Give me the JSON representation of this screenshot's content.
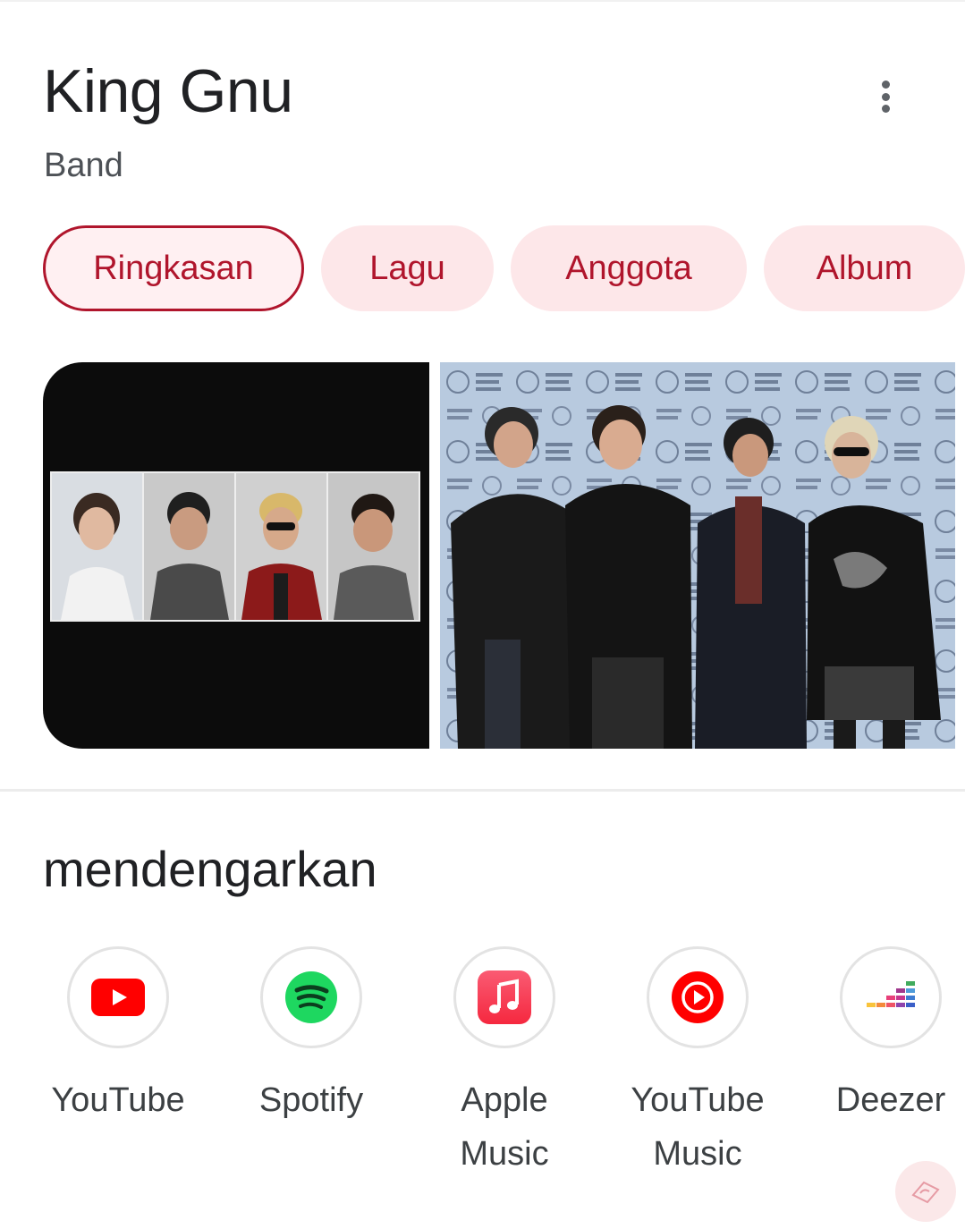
{
  "header": {
    "title": "King Gnu",
    "subtitle": "Band"
  },
  "tabs": [
    {
      "label": "Ringkasan",
      "active": true
    },
    {
      "label": "Lagu",
      "active": false
    },
    {
      "label": "Anggota",
      "active": false
    },
    {
      "label": "Album",
      "active": false
    }
  ],
  "listen": {
    "title": "mendengarkan",
    "services": [
      {
        "label": "YouTube",
        "icon": "youtube-icon",
        "color": "#ff0000"
      },
      {
        "label": "Spotify",
        "icon": "spotify-icon",
        "color": "#1ed760"
      },
      {
        "label": "Apple\nMusic",
        "icon": "apple-music-icon",
        "color": "#fa3c55"
      },
      {
        "label": "YouTube\nMusic",
        "icon": "youtube-music-icon",
        "color": "#ff0000"
      },
      {
        "label": "Deezer",
        "icon": "deezer-icon",
        "color": "#ef5466"
      }
    ]
  },
  "colors": {
    "accent": "#b0152c",
    "chip_bg": "#fde7e9"
  }
}
